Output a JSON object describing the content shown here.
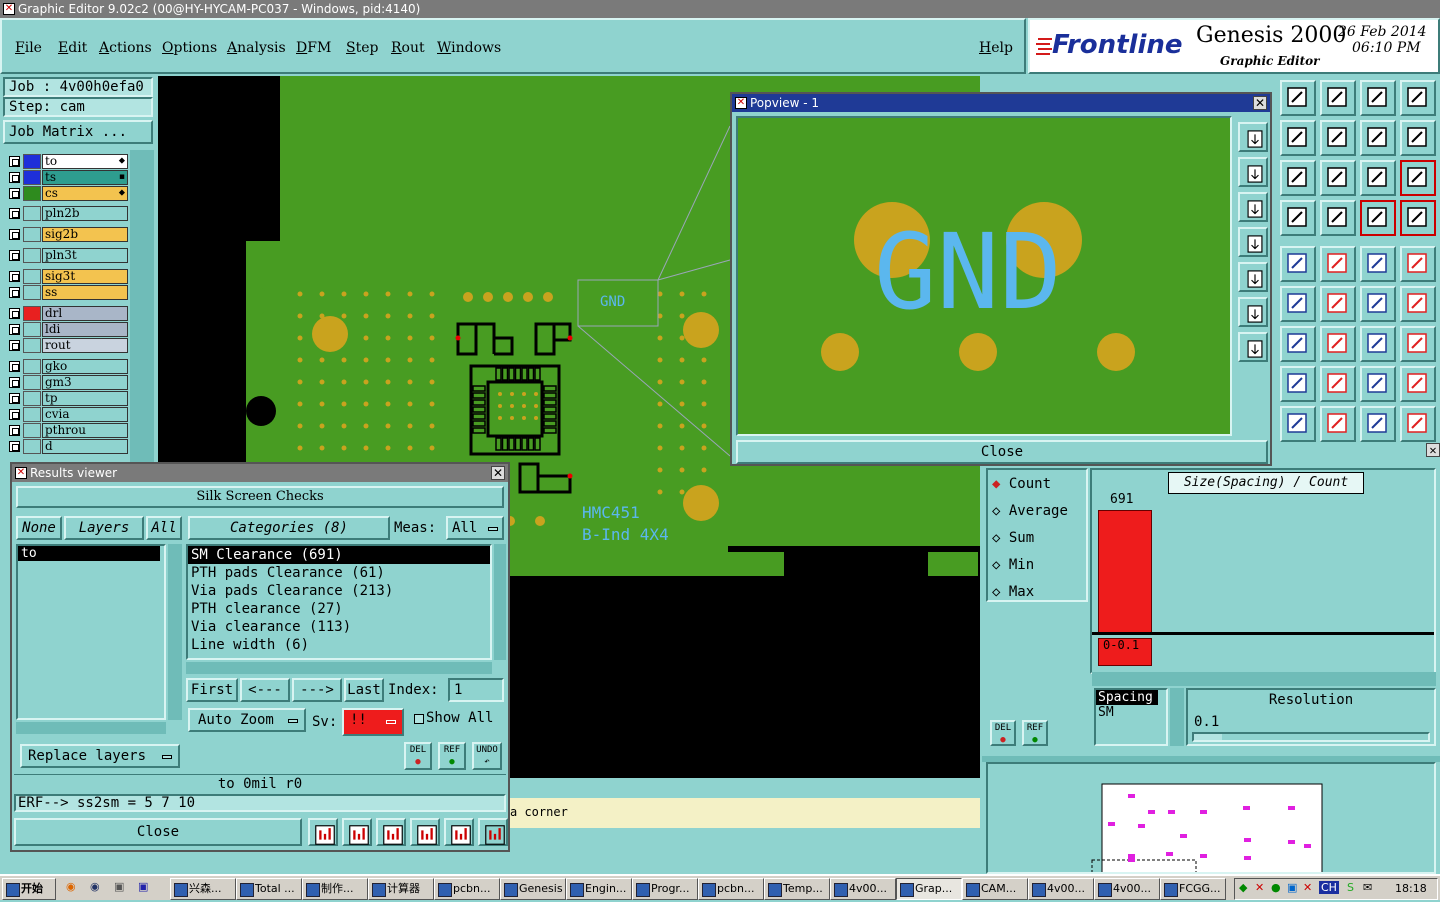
{
  "window": {
    "title": "Graphic Editor 9.02c2 (00@HY-HYCAM-PC037 - Windows, pid:4140)"
  },
  "menu": {
    "items": [
      "File",
      "Edit",
      "Actions",
      "Options",
      "Analysis",
      "DFM",
      "Step",
      "Rout",
      "Windows"
    ],
    "help": "Help"
  },
  "brand": {
    "logo": "Frontline",
    "product": "Genesis 2000",
    "subtitle": "Graphic Editor",
    "date": "26 Feb 2014",
    "time": "06:10 PM"
  },
  "job": {
    "job_label": "Job : 4v00h0efa0",
    "step_label": "Step: cam",
    "matrix_button": "Job Matrix ..."
  },
  "layers": [
    {
      "name": "to",
      "color": "#ffffff",
      "swatch": "#1e2fd9",
      "mark": "⬥"
    },
    {
      "name": "ts",
      "color": "#2e9d8f",
      "swatch": "#1e2fd9",
      "mark": "▪"
    },
    {
      "name": "cs",
      "color": "#f3c34f",
      "swatch": "#2e8b1e",
      "mark": "⬥"
    },
    {
      "name": "pln2b",
      "color": "#8fd3cf",
      "swatch": "#8fd3cf",
      "mark": ""
    },
    {
      "name": "sig2b",
      "color": "#f3c34f",
      "swatch": "#8fd3cf",
      "mark": ""
    },
    {
      "name": "pln3t",
      "color": "#8fd3cf",
      "swatch": "#8fd3cf",
      "mark": ""
    },
    {
      "name": "sig3t",
      "color": "#f3c34f",
      "swatch": "#8fd3cf",
      "mark": ""
    },
    {
      "name": "ss",
      "color": "#f3c34f",
      "swatch": "#8fd3cf",
      "mark": ""
    },
    {
      "name": "drl",
      "color": "#a9b6c8",
      "swatch": "#e82020",
      "mark": ""
    },
    {
      "name": "ldi",
      "color": "#a9b6c8",
      "swatch": "#8fd3cf",
      "mark": ""
    },
    {
      "name": "rout",
      "color": "#c9d3df",
      "swatch": "#8fd3cf",
      "mark": ""
    },
    {
      "name": "gko",
      "color": "#8fd3cf",
      "swatch": "#8fd3cf",
      "mark": ""
    },
    {
      "name": "gm3",
      "color": "#8fd3cf",
      "swatch": "#8fd3cf",
      "mark": ""
    },
    {
      "name": "tp",
      "color": "#8fd3cf",
      "swatch": "#8fd3cf",
      "mark": ""
    },
    {
      "name": "cvia",
      "color": "#8fd3cf",
      "swatch": "#8fd3cf",
      "mark": ""
    },
    {
      "name": "pthrou",
      "color": "#8fd3cf",
      "swatch": "#8fd3cf",
      "mark": ""
    },
    {
      "name": "d",
      "color": "#8fd3cf",
      "swatch": "#8fd3cf",
      "mark": ""
    }
  ],
  "board": {
    "labels": {
      "gnd": "GND",
      "part": "HMC451",
      "part2": "B-Ind 4X4"
    },
    "status_fragment": "a corner"
  },
  "popview": {
    "title": "Popview - 1",
    "close": "Close",
    "text": "GND"
  },
  "results": {
    "title": "Results viewer",
    "heading": "Silk Screen Checks",
    "none": "None",
    "layers": "Layers",
    "all": "All",
    "layer_items": [
      "to"
    ],
    "categories_label": "Categories (8)",
    "meas_label": "Meas:",
    "meas_value": "All",
    "categories": [
      "SM Clearance (691)",
      "PTH pads Clearance (61)",
      "Via pads Clearance (213)",
      "PTH clearance (27)",
      "Via clearance (113)",
      "Line width (6)"
    ],
    "nav": {
      "first": "First",
      "prev": "<---",
      "next": "--->",
      "last": "Last",
      "index_label": "Index:",
      "index_value": "1"
    },
    "auto_zoom": "Auto Zoom",
    "sv_label": "Sv:",
    "sv_value": "!!",
    "show_all": "Show All",
    "replace_layers": "Replace layers",
    "icon_del": "DEL",
    "icon_ref": "REF",
    "icon_undo": "UNDO",
    "status": "to 0mil  r0",
    "erf": "ERF--> ss2sm = 5 7 10",
    "close": "Close"
  },
  "stats": {
    "options": [
      "Count",
      "Average",
      "Sum",
      "Min",
      "Max"
    ],
    "selected": "Count",
    "chart_title": "Size(Spacing) / Count",
    "bar_value": "691",
    "bar_range": "0-0.1",
    "spacing_items": [
      "Spacing",
      "SM"
    ],
    "resolution_label": "Resolution",
    "resolution_value": "0.1",
    "del": "DEL",
    "ref": "REF"
  },
  "taskbar": {
    "start": "开始",
    "tasks": [
      "兴森...",
      "Total ...",
      "制作...",
      "计算器",
      "pcbn...",
      "Genesis",
      "Engin...",
      "Progr...",
      "pcbn...",
      "Temp...",
      "4v00...",
      "Grap...",
      "CAM...",
      "4v00...",
      "4v00...",
      "FCGG..."
    ],
    "tray": "CH",
    "clock": "18:18"
  }
}
